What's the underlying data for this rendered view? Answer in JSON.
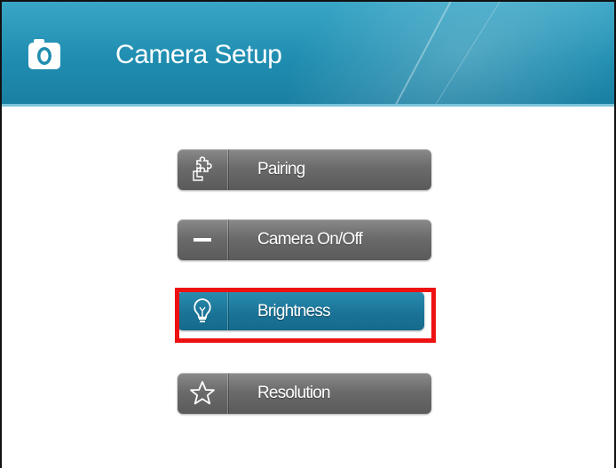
{
  "header": {
    "title": "Camera Setup",
    "icon": "camera-icon",
    "background_color": "#1f8db0"
  },
  "menu": {
    "items": [
      {
        "label": "Pairing",
        "icon": "puzzle-icon",
        "selected": false
      },
      {
        "label": "Camera On/Off",
        "icon": "toggle-icon",
        "selected": false
      },
      {
        "label": "Brightness",
        "icon": "lightbulb-icon",
        "selected": true
      },
      {
        "label": "Resolution",
        "icon": "star-icon",
        "selected": false
      }
    ],
    "button_color": "#6b6b6b",
    "selected_color": "#1a7497",
    "highlight_color": "#ee1111"
  }
}
